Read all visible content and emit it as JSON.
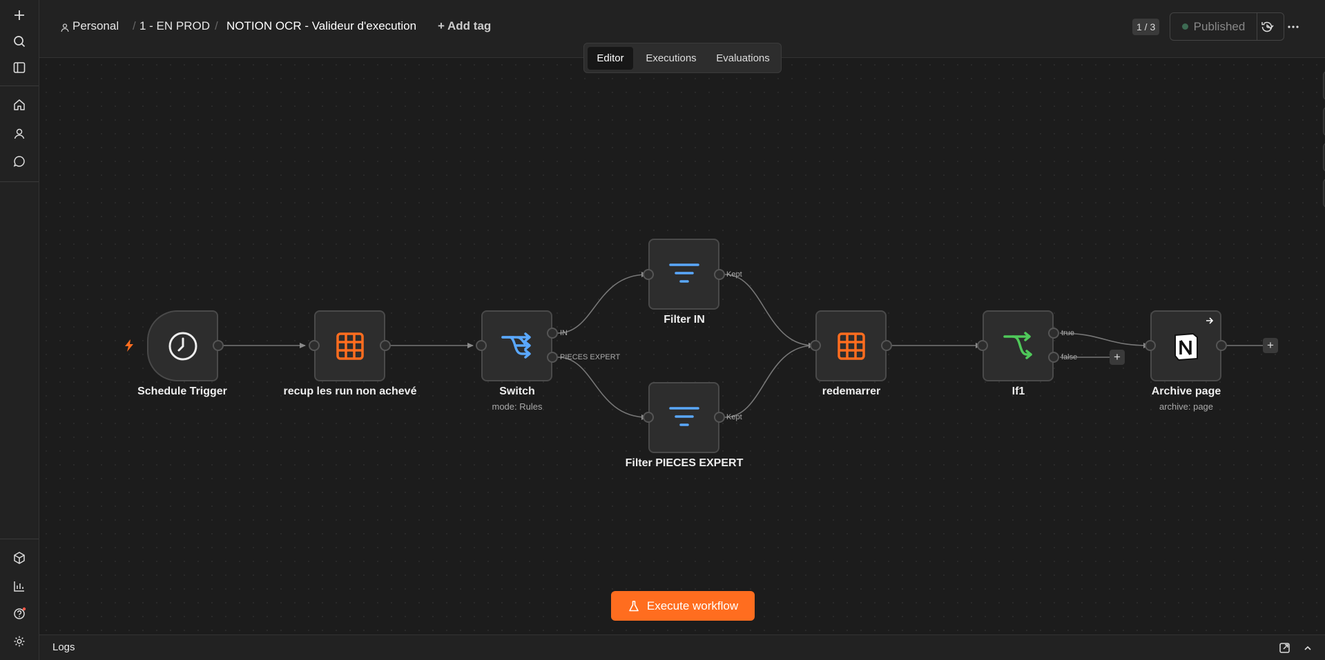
{
  "header": {
    "project": "Personal",
    "folder": "1 - EN PROD",
    "workflow_name": "NOTION OCR - Valideur d'execution",
    "add_tag": "+ Add tag",
    "version_counter": "1 / 3",
    "publish_status": "Published"
  },
  "tabs": [
    "Editor",
    "Executions",
    "Evaluations"
  ],
  "nodes": {
    "schedule": {
      "label": "Schedule Trigger"
    },
    "recup": {
      "label": "recup les run non achevé"
    },
    "switch": {
      "label": "Switch",
      "sub": "mode: Rules",
      "out1": "IN",
      "out2": "PIECES EXPERT"
    },
    "filter_in": {
      "label": "Filter IN",
      "out": "Kept"
    },
    "filter_pieces": {
      "label": "Filter PIECES EXPERT",
      "out": "Kept"
    },
    "redemarrer": {
      "label": "redemarrer"
    },
    "if1": {
      "label": "If1",
      "out_true": "true",
      "out_false": "false"
    },
    "archive": {
      "label": "Archive page",
      "sub": "archive: page"
    }
  },
  "execute_button": "Execute workflow",
  "logs_label": "Logs",
  "colors": {
    "accent": "#ff6d1f",
    "table_icon": "#ff6d1f",
    "switch_icon": "#5aa8ff",
    "if_icon": "#4fc95a"
  }
}
